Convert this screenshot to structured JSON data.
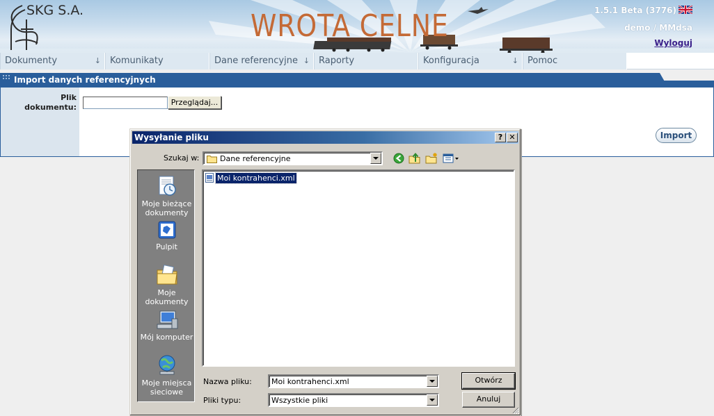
{
  "header": {
    "company": "SKG S.A.",
    "app_title": "WROTA CELNE",
    "version": "1.5.1 Beta (3776)",
    "user": "demo / MMdsa",
    "logout": "Wyloguj"
  },
  "menu": {
    "items": [
      {
        "label": "Dokumenty",
        "has_arrow": true
      },
      {
        "label": "Komunikaty",
        "has_arrow": false
      },
      {
        "label": "Dane referencyjne",
        "has_arrow": true
      },
      {
        "label": "Raporty",
        "has_arrow": false
      },
      {
        "label": "Konfiguracja",
        "has_arrow": true
      },
      {
        "label": "Pomoc",
        "has_arrow": false
      }
    ],
    "arrow_glyph": "↓"
  },
  "panel": {
    "title": "Import danych referencyjnych",
    "file_label": "Plik dokumentu:",
    "browse_label": "Przeglądaj...",
    "import_label": "Import"
  },
  "dialog": {
    "title": "Wysyłanie pliku",
    "help_label": "?",
    "close_label": "✕",
    "look_in_label": "Szukaj w:",
    "look_in_value": "Dane referencyjne",
    "places": [
      {
        "label": "Moje bieżące dokumenty",
        "icon": "recent-documents-icon"
      },
      {
        "label": "Pulpit",
        "icon": "desktop-icon"
      },
      {
        "label": "Moje dokumenty",
        "icon": "my-documents-icon"
      },
      {
        "label": "Mój komputer",
        "icon": "my-computer-icon"
      },
      {
        "label": "Moje miejsca sieciowe",
        "icon": "network-places-icon"
      }
    ],
    "files": [
      {
        "name": "Moi kontrahenci.xml",
        "selected": true
      }
    ],
    "filename_label": "Nazwa pliku:",
    "filename_value": "Moi kontrahenci.xml",
    "filetype_label": "Pliki typu:",
    "filetype_value": "Wszystkie pliki",
    "open_label": "Otwórz",
    "cancel_label": "Anuluj"
  },
  "colors": {
    "panel_title_bg": "#2a5e9b",
    "app_title": "#c46a36",
    "dialog_titlebar": "#0a246a",
    "selection": "#0a246a"
  }
}
